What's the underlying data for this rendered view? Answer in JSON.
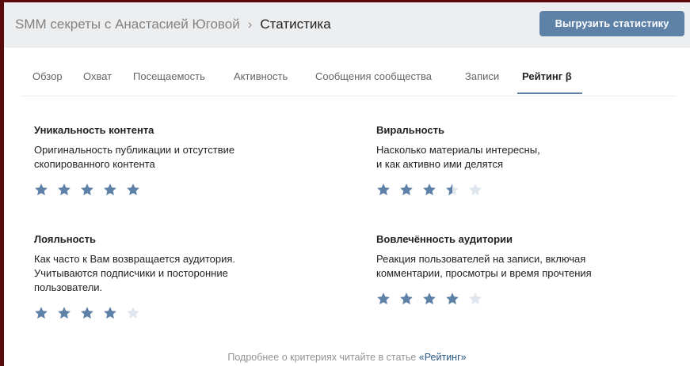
{
  "header": {
    "community": "SMM секреты с Анастасией Юговой",
    "separator": "›",
    "section": "Статистика",
    "export_button": "Выгрузить статистику"
  },
  "tabs": [
    "Обзор",
    "Охват",
    "Посещаемость",
    "Активность",
    "Сообщения сообщества",
    "Записи",
    "Рейтинг β"
  ],
  "active_tab": "Рейтинг β",
  "ratings": [
    {
      "title": "Уникальность контента",
      "description": "Оригинальность публикации и отсутствие\nскопированного контента",
      "stars": 5,
      "max_stars": 5
    },
    {
      "title": "Виральность",
      "description": "Насколько материалы интересны,\nи как активно ими делятся",
      "stars": 3.5,
      "max_stars": 5
    },
    {
      "title": "Лояльность",
      "description": "Как часто к Вам возвращается аудитория.\nУчитываются подписчики и посторонние\nпользователи.",
      "stars": 4,
      "max_stars": 5
    },
    {
      "title": "Вовлечённость аудитории",
      "description": "Реакция пользователей на записи, включая\nкомментарии, просмотры и время прочтения",
      "stars": 4,
      "max_stars": 5
    }
  ],
  "footer": {
    "text": "Подробнее о критериях читайте в статье ",
    "link": "«Рейтинг»"
  },
  "colors": {
    "accent": "#5e81a8",
    "star_filled": "#5e81a8",
    "star_empty": "#dfe6ee",
    "header_bg": "#edeef0",
    "outer_bg": "#5a0a0a"
  }
}
